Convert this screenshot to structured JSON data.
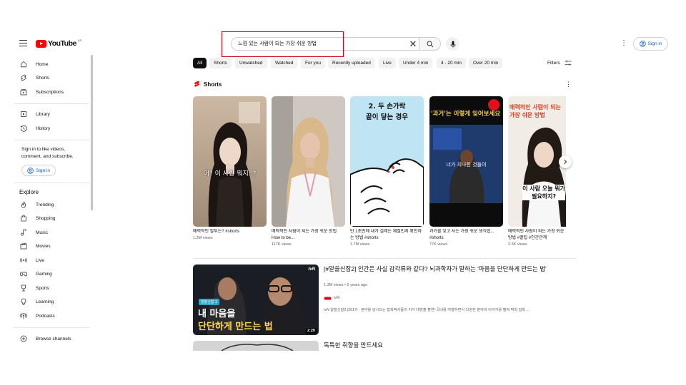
{
  "header": {
    "logo_text": "YouTube",
    "logo_region": "KR",
    "search_value": "느낌 있는 사람이 되는 가장 쉬운 방법",
    "clear_glyph": "✕",
    "more_glyph": "⋮",
    "signin_label": "Sign in"
  },
  "sidebar": {
    "main": [
      {
        "label": "Home",
        "icon": "home-icon"
      },
      {
        "label": "Shorts",
        "icon": "shorts-icon"
      },
      {
        "label": "Subscriptions",
        "icon": "subscriptions-icon"
      }
    ],
    "you": [
      {
        "label": "Library",
        "icon": "library-icon"
      },
      {
        "label": "History",
        "icon": "history-icon"
      }
    ],
    "signin_prompt": "Sign in to like videos, comment, and subscribe.",
    "signin_label": "Sign in",
    "explore_heading": "Explore",
    "explore": [
      {
        "label": "Trending",
        "icon": "trending-icon"
      },
      {
        "label": "Shopping",
        "icon": "shopping-icon"
      },
      {
        "label": "Music",
        "icon": "music-icon"
      },
      {
        "label": "Movies",
        "icon": "movies-icon"
      },
      {
        "label": "Live",
        "icon": "live-icon"
      },
      {
        "label": "Gaming",
        "icon": "gaming-icon"
      },
      {
        "label": "Sports",
        "icon": "sports-icon"
      },
      {
        "label": "Learning",
        "icon": "learning-icon"
      },
      {
        "label": "Podcasts",
        "icon": "podcasts-icon"
      }
    ],
    "browse_channels": "Browse channels"
  },
  "chips": [
    "All",
    "Shorts",
    "Unwatched",
    "Watched",
    "For you",
    "Recently uploaded",
    "Live",
    "Under 4 min",
    "4 - 20 min",
    "Over 20 min"
  ],
  "filters_label": "Filters",
  "shorts": {
    "heading": "Shorts",
    "items": [
      {
        "title": "매력적인 말투는? #shorts",
        "views": "1.3M views",
        "overlay": "어? 이 사람 뭐지..?"
      },
      {
        "title": "매력적인 사람이 되는 가장 쉬운 방법 How to be...",
        "views": "117K views",
        "overlay": ""
      },
      {
        "title": "만 1초만에 내가 설레는 체질인지 확인하는 방법 #shorts",
        "views": "1.7M views",
        "overlay_top": "2. 두 손가락",
        "overlay_bottom": "끝이 닿는 경우"
      },
      {
        "title": "과거를 잊고 사는 가장 쉬운 생각법... #shorts",
        "views": "77K views",
        "overlay_top": "'과거'는 이렇게 잊어보세요",
        "overlay_mid": "너가 지나친 것들이"
      },
      {
        "title": "매력적인 사람이 되는 가장 쉬운 방법 #꿀팁 #인간관계",
        "views": "2.3K views",
        "overlay_top": "매력적인 사람이 되는 가장 쉬운 방법",
        "overlay_bottom": "이 사람 오늘 뭐가 필요하지?"
      }
    ]
  },
  "videos": [
    {
      "title": "[#알쓸신잡2] 인간은 사실 감각류와 같다? 뇌과학자가 말하는 '마음을 단단하게 만드는 법'",
      "meta": "1.3M views • 5 years ago",
      "channel": "tvN",
      "description": "tvN 알쓸신잡2 (2017) : 분야를 넘나드는 잡학박사들의 지식 대방출 향연! 국내를 여행하면서 다양한 분야의 이야기를 펼쳐 박학 잡학 ...",
      "duration": "2:20",
      "thumb_badge": "알쓸신잡 2",
      "thumb_line1": "내 마음을",
      "thumb_line2": "단단하게 만드는 법",
      "thumb_logo": "tvN"
    },
    {
      "title": "독특한 취향을 만드세요"
    }
  ]
}
